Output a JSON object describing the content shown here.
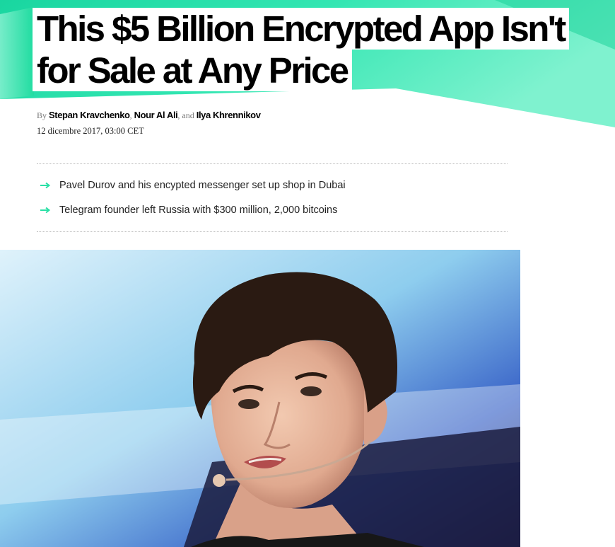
{
  "headline": {
    "line1": "This $5 Billion Encrypted App Isn't",
    "line2": "for Sale at Any Price"
  },
  "byline": {
    "prefix": "By",
    "authors": [
      "Stepan Kravchenko",
      "Nour Al Ali",
      "Ilya Khrennikov"
    ],
    "comma": ",",
    "and": ", and",
    "date": "12 dicembre 2017, 03:00 CET"
  },
  "summary": {
    "items": [
      "Pavel Durov and his encypted messenger set up shop in Dubai",
      "Telegram founder left Russia with $300 million, 2,000 bitcoins"
    ]
  },
  "icons": {
    "bullet": "right-arrow-icon"
  },
  "colors": {
    "accent": "#2be0a6",
    "banner_light": "#7ff0cc",
    "text": "#000000"
  }
}
